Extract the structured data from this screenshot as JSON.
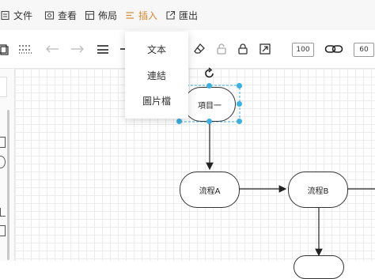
{
  "menubar": {
    "items": [
      {
        "label": "文件",
        "icon": "file-icon"
      },
      {
        "label": "查看",
        "icon": "view-icon"
      },
      {
        "label": "佈局",
        "icon": "layout-icon"
      },
      {
        "label": "插入",
        "icon": "insert-icon",
        "active": true
      },
      {
        "label": "匯出",
        "icon": "export-icon"
      }
    ]
  },
  "toolbar": {
    "font_size_value": "100",
    "zoom_value": "60"
  },
  "insert_menu": {
    "items": [
      "文本",
      "連結",
      "圖片檔"
    ]
  },
  "flowchart": {
    "nodes": [
      {
        "id": "n1",
        "label": "項目一",
        "selected": true
      },
      {
        "id": "n2",
        "label": "流程A"
      },
      {
        "id": "n3",
        "label": "流程B"
      }
    ]
  },
  "colors": {
    "accent": "#d58a2c",
    "selection_handle": "#3cb0e0",
    "grid": "#ececec"
  }
}
